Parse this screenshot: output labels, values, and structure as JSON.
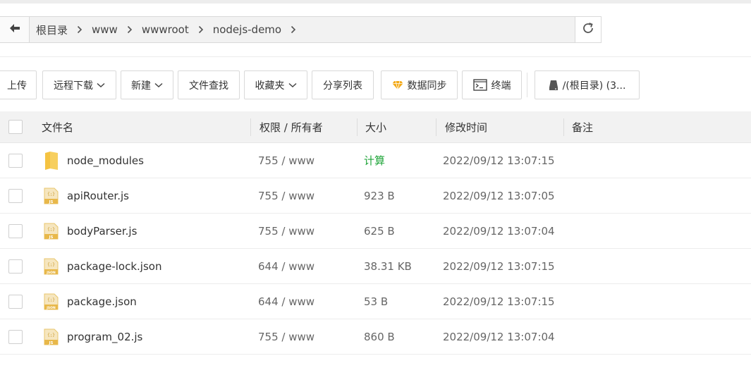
{
  "path": {
    "crumbs": [
      "根目录",
      "www",
      "wwwroot",
      "nodejs-demo"
    ]
  },
  "toolbar": {
    "upload": "上传",
    "remote_download": "远程下载",
    "new": "新建",
    "file_search": "文件查找",
    "favorites": "收藏夹",
    "share_list": "分享列表",
    "data_sync": "数据同步",
    "terminal": "终端",
    "disk": "/(根目录) (3..."
  },
  "table": {
    "headers": {
      "name": "文件名",
      "perm": "权限 / 所有者",
      "size": "大小",
      "mtime": "修改时间",
      "note": "备注"
    },
    "rows": [
      {
        "name": "node_modules",
        "type": "folder",
        "perm": "755 / www",
        "size": "计算",
        "mtime": "2022/09/12 13:07:15"
      },
      {
        "name": "apiRouter.js",
        "type": "js",
        "perm": "755 / www",
        "size": "923 B",
        "mtime": "2022/09/12 13:07:05"
      },
      {
        "name": "bodyParser.js",
        "type": "js",
        "perm": "755 / www",
        "size": "625 B",
        "mtime": "2022/09/12 13:07:04"
      },
      {
        "name": "package-lock.json",
        "type": "json",
        "perm": "644 / www",
        "size": "38.31 KB",
        "mtime": "2022/09/12 13:07:15"
      },
      {
        "name": "package.json",
        "type": "json",
        "perm": "644 / www",
        "size": "53 B",
        "mtime": "2022/09/12 13:07:15"
      },
      {
        "name": "program_02.js",
        "type": "js",
        "perm": "755 / www",
        "size": "860 B",
        "mtime": "2022/09/12 13:07:04"
      }
    ]
  },
  "icons": {
    "back": "arrow-left-icon",
    "refresh": "refresh-icon",
    "sync": "diamond-icon",
    "terminal": "terminal-icon",
    "disk": "disk-icon"
  },
  "colors": {
    "accent_green": "#20a53a",
    "file_icon": "#e8b84a",
    "folder": "#f5c342",
    "sync_icon": "#f3a917"
  },
  "file_icon_labels": {
    "js": "JS",
    "json": "JSON"
  }
}
